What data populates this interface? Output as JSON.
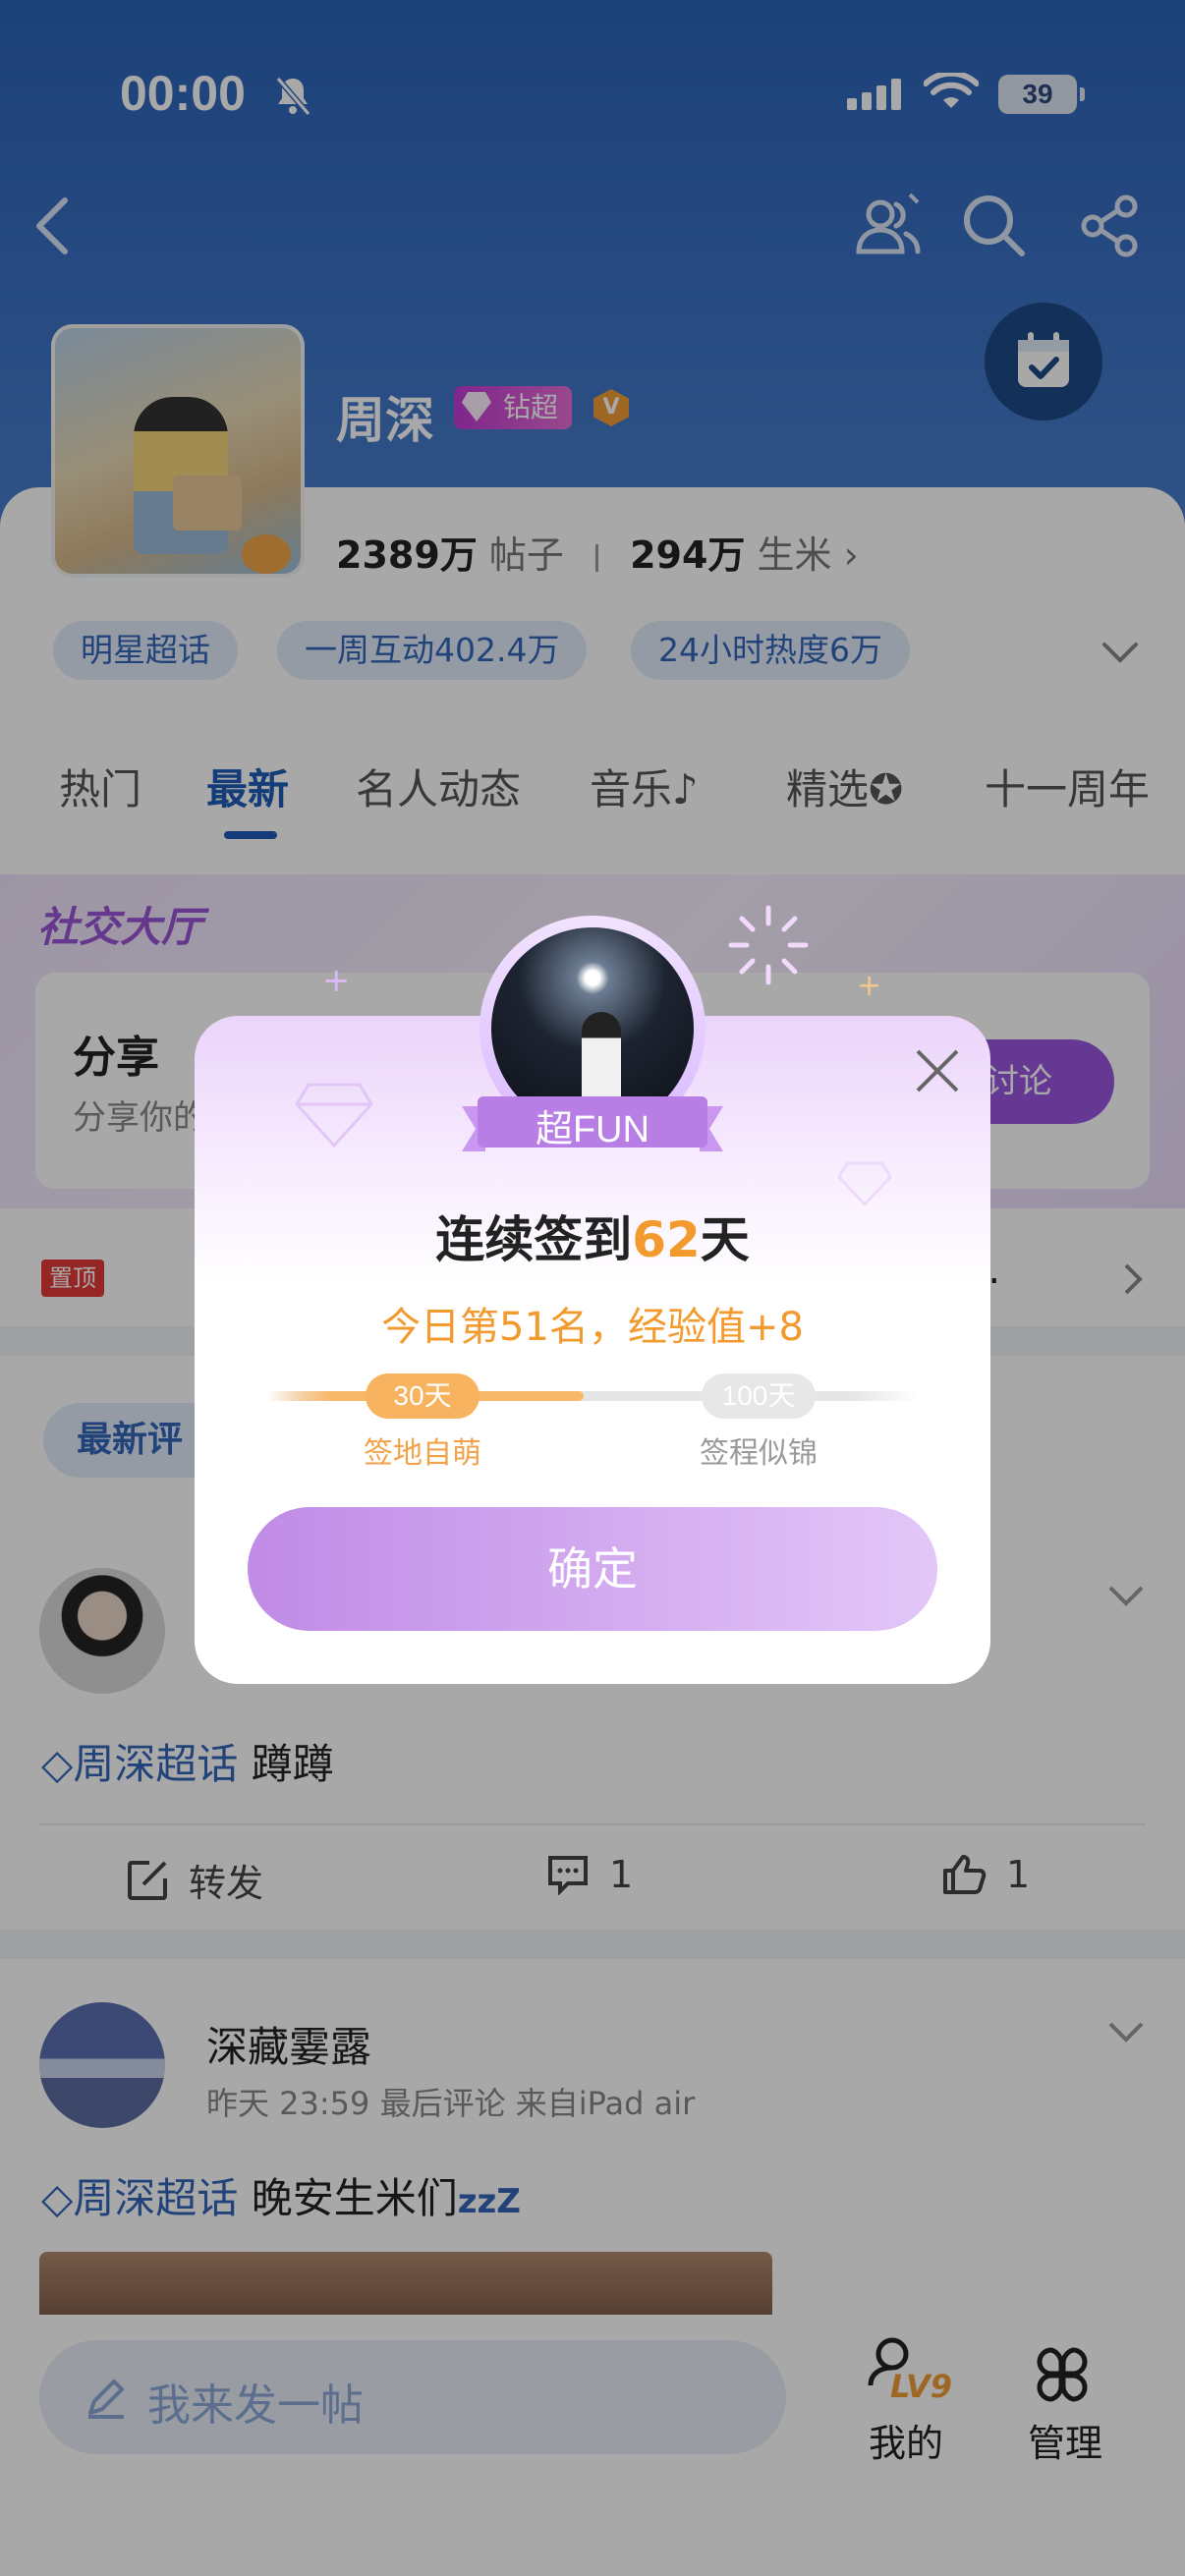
{
  "status_bar": {
    "time": "00:00",
    "battery": "39"
  },
  "header": {
    "name": "周深",
    "badge": "钻超",
    "verified": "V",
    "stats": {
      "posts_value": "2389万",
      "posts_label": "帖子",
      "fans_value": "294万",
      "fans_label": "生米"
    },
    "chips": [
      "明星超话",
      "一周互动402.4万",
      "24小时热度6万"
    ]
  },
  "tabs": [
    "热门",
    "最新",
    "名人动态",
    "音乐",
    "精选",
    "十一周年"
  ],
  "plaza": {
    "title": "社交大厅",
    "share_title": "分享",
    "share_desc": "分享你的",
    "join_label": "讨论"
  },
  "pinned": {
    "badge": "置顶",
    "text": "【",
    "trail": "..."
  },
  "sort_chip": "最新评",
  "post1": {
    "topic": "周深超话",
    "text": "蹲蹲",
    "repost": "转发",
    "comments": "1",
    "likes": "1"
  },
  "post2": {
    "user": "深藏霎露",
    "meta": "昨天 23:59  最后评论  来自iPad air",
    "topic": "周深超话",
    "text": "晚安生米们",
    "zz": "zzZ"
  },
  "bottom": {
    "compose_placeholder": "我来发一帖",
    "mine_label": "我的",
    "level": "LV9",
    "manage_label": "管理"
  },
  "dialog": {
    "ribbon": "超FUN",
    "title_prefix": "连续签到",
    "days": "62",
    "title_suffix": "天",
    "subtitle": "今日第51名，经验值+8",
    "milestone1_label": "30天",
    "milestone1_name": "签地自萌",
    "milestone2_label": "100天",
    "milestone2_name": "签程似锦",
    "progress_days": 62,
    "confirm": "确定"
  },
  "colors": {
    "brand_blue": "#1e5bb8",
    "accent_orange": "#f39a2e",
    "accent_purple": "#9a55e0"
  }
}
